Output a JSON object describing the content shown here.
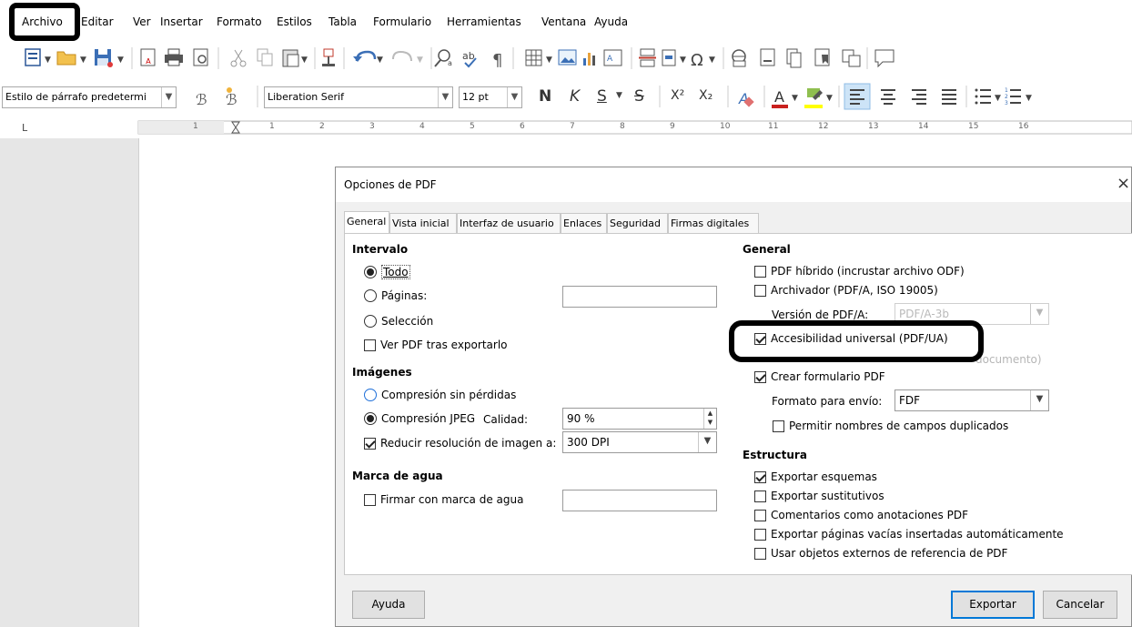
{
  "menubar": {
    "items": [
      "Archivo",
      "Editar",
      "Ver",
      "Insertar",
      "Formato",
      "Estilos",
      "Tabla",
      "Formulario",
      "Herramientas",
      "Ventana",
      "Ayuda"
    ]
  },
  "formatting_toolbar": {
    "paragraph_style": "Estilo de párrafo predetermi",
    "font_name": "Liberation Serif",
    "font_size": "12 pt",
    "bold": "N",
    "italic": "K",
    "underline": "S",
    "strikethrough": "S",
    "superscript": "X²",
    "subscript": "X₂"
  },
  "ruler": {
    "marks": [
      "1",
      "1",
      "2",
      "3",
      "4",
      "5",
      "6",
      "7",
      "8",
      "9",
      "10",
      "11",
      "12",
      "13",
      "14",
      "15",
      "16"
    ]
  },
  "dialog": {
    "title": "Opciones de PDF",
    "close": "×",
    "tabs": [
      "General",
      "Vista inicial",
      "Interfaz de usuario",
      "Enlaces",
      "Seguridad",
      "Firmas digitales"
    ],
    "intervalo": {
      "title": "Intervalo",
      "todo": "Todo",
      "paginas": "Páginas:",
      "seleccion": "Selección",
      "ver_pdf": "Ver PDF tras exportarlo"
    },
    "imagenes": {
      "title": "Imágenes",
      "sin_perdidas": "Compresión sin pérdidas",
      "jpeg": "Compresión JPEG",
      "calidad": "Calidad:",
      "calidad_value": "90 %",
      "reducir": "Reducir resolución de imagen a:",
      "dpi_value": "300 DPI"
    },
    "marca_agua": {
      "title": "Marca de agua",
      "firmar": "Firmar con marca de agua"
    },
    "general": {
      "title": "General",
      "hibrido": "PDF híbrido (incrustar archivo ODF)",
      "archivador": "Archivador (PDF/A, ISO 19005)",
      "version_label": "Versión de PDF/A:",
      "version_value": "PDF/A-3b",
      "accesibilidad": "Accesibilidad universal (PDF/UA)",
      "hidden_tail": "documento)",
      "crear_formulario": "Crear formulario PDF",
      "formato_envio_label": "Formato para envío:",
      "formato_envio_value": "FDF",
      "permitir_duplicados": "Permitir nombres de campos duplicados"
    },
    "estructura": {
      "title": "Estructura",
      "esquemas": "Exportar esquemas",
      "sustitutivos": "Exportar sustitutivos",
      "comentarios": "Comentarios como anotaciones PDF",
      "paginas_vacias": "Exportar páginas vacías insertadas automáticamente",
      "objetos_externos": "Usar objetos externos de referencia de PDF"
    },
    "buttons": {
      "ayuda": "Ayuda",
      "exportar": "Exportar",
      "cancelar": "Cancelar"
    }
  }
}
